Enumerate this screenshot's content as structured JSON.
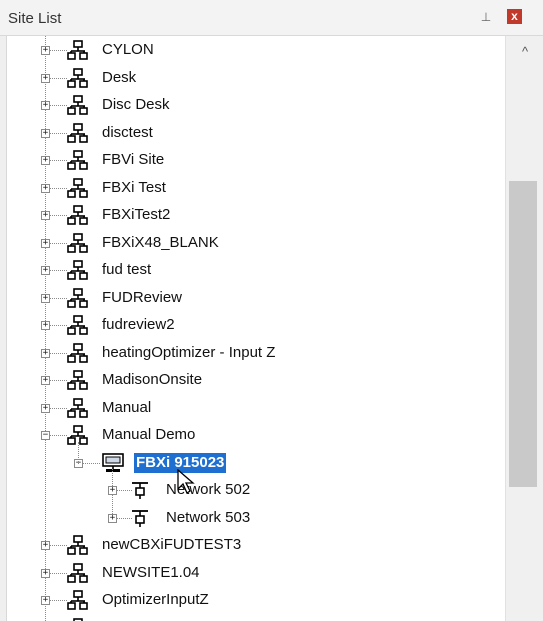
{
  "panel": {
    "title": "Site List",
    "pin_glyph": "⊥",
    "close_glyph": "x"
  },
  "tree": {
    "sites": [
      {
        "label": "CYLON"
      },
      {
        "label": "Desk"
      },
      {
        "label": "Disc Desk"
      },
      {
        "label": "disctest"
      },
      {
        "label": "FBVi Site"
      },
      {
        "label": "FBXi Test"
      },
      {
        "label": "FBXiTest2"
      },
      {
        "label": "FBXiX48_BLANK"
      },
      {
        "label": "fud test"
      },
      {
        "label": "FUDReview"
      },
      {
        "label": "fudreview2"
      },
      {
        "label": "heatingOptimizer - Input Z"
      },
      {
        "label": "MadisonOnsite"
      },
      {
        "label": "Manual"
      },
      {
        "label": "Manual Demo",
        "expanded": true
      }
    ],
    "device": {
      "label": "FBXi 915023",
      "selected": true
    },
    "networks": [
      {
        "label": "Network 502"
      },
      {
        "label": "Network 503"
      }
    ],
    "sites_after": [
      {
        "label": "newCBXiFUDTEST3"
      },
      {
        "label": "NEWSITE1.04"
      },
      {
        "label": "OptimizerInputZ"
      }
    ]
  },
  "colors": {
    "selection": "#1e6fd0",
    "close_button": "#c0392b",
    "scroll_thumb": "#c9c9c9"
  },
  "icons": {
    "site": "site-network-icon",
    "device": "controller-icon",
    "network": "network-icon",
    "expander_plus": "+",
    "expander_minus": "−",
    "scroll_up": "^"
  }
}
